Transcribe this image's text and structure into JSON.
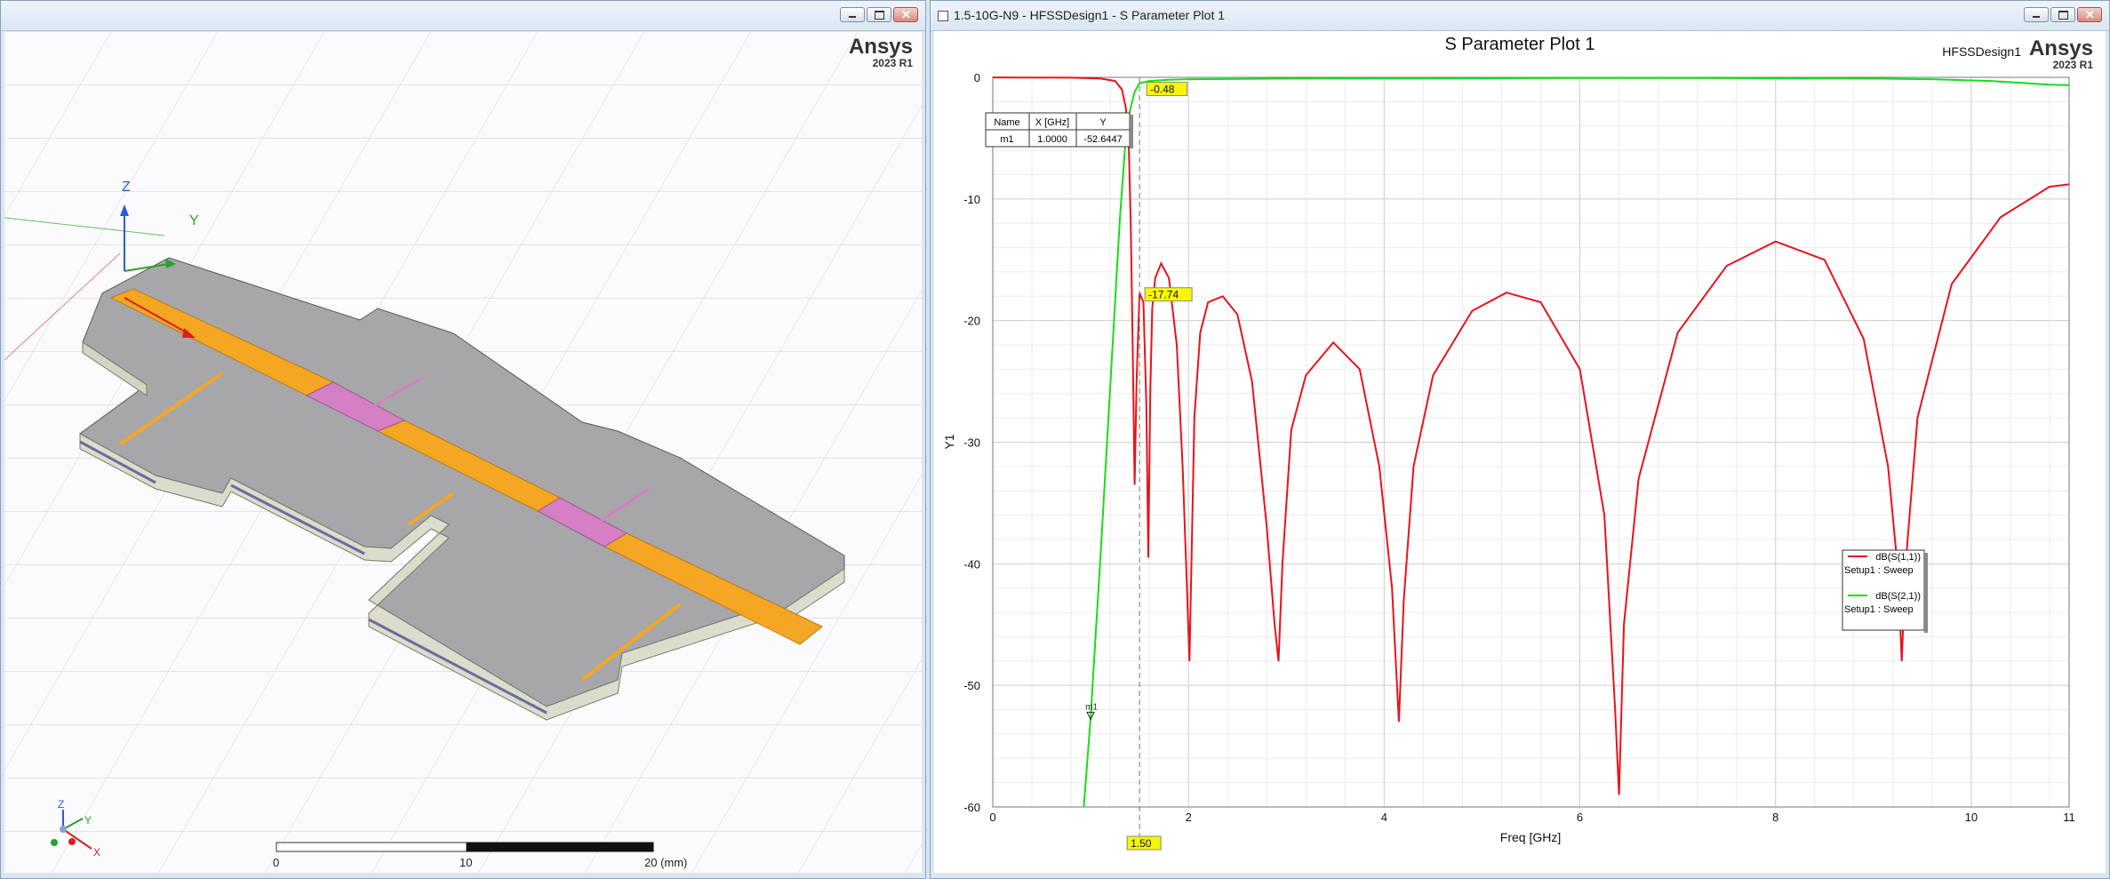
{
  "left_window": {
    "brand": {
      "name": "Ansys",
      "version": "2023 R1"
    },
    "axes": {
      "z": "Z",
      "y": "Y",
      "x": "X"
    },
    "scale_bar": {
      "labels": [
        "0",
        "10",
        "20 (mm)"
      ]
    }
  },
  "right_window": {
    "title": "1.5-10G-N9 - HFSSDesign1 - S Parameter Plot 1",
    "brand": {
      "name": "Ansys",
      "version": "2023 R1"
    },
    "design_label": "HFSSDesign1",
    "marker_table": {
      "headers": [
        "Name",
        "X [GHz]",
        "Y"
      ],
      "row": [
        "m1",
        "1.0000",
        "-52.6447"
      ]
    },
    "legend": [
      {
        "name": "dB(S(1,1))",
        "sub": "Setup1 : Sweep",
        "color": "#e8131b"
      },
      {
        "name": "dB(S(2,1))",
        "sub": "Setup1 : Sweep",
        "color": "#19dc19"
      }
    ],
    "cursor_labels": {
      "x": "1.50",
      "s21": "-0.48",
      "s11": "-17.74",
      "marker": "m1"
    }
  },
  "chart_data": {
    "type": "line",
    "title": "S Parameter Plot 1",
    "xlabel": "Freq [GHz]",
    "ylabel": "Y1",
    "xlim": [
      0,
      11
    ],
    "ylim": [
      -60,
      0
    ],
    "xticks": [
      0,
      2,
      4,
      6,
      8,
      10,
      11
    ],
    "yticks": [
      0,
      -10,
      -20,
      -30,
      -40,
      -50,
      -60
    ],
    "grid": true,
    "legend_position": "right",
    "series": [
      {
        "name": "dB(S(1,1))",
        "color": "#e8131b",
        "x": [
          0,
          0.8,
          1.1,
          1.25,
          1.32,
          1.36,
          1.39,
          1.41,
          1.43,
          1.45,
          1.47,
          1.5,
          1.54,
          1.57,
          1.59,
          1.61,
          1.63,
          1.66,
          1.72,
          1.8,
          1.88,
          1.94,
          1.98,
          2.01,
          2.03,
          2.06,
          2.12,
          2.2,
          2.35,
          2.5,
          2.65,
          2.8,
          2.88,
          2.92,
          2.96,
          3.05,
          3.2,
          3.48,
          3.75,
          3.95,
          4.08,
          4.15,
          4.2,
          4.3,
          4.5,
          4.9,
          5.25,
          5.6,
          6.0,
          6.25,
          6.36,
          6.4,
          6.45,
          6.6,
          7.0,
          7.5,
          8.0,
          8.5,
          8.9,
          9.15,
          9.25,
          9.29,
          9.33,
          9.45,
          9.8,
          10.3,
          10.8,
          11.0
        ],
        "y": [
          -0.01,
          -0.03,
          -0.1,
          -0.3,
          -1.0,
          -2.5,
          -5.5,
          -12,
          -22,
          -33.5,
          -25,
          -17.74,
          -18.5,
          -27,
          -39.5,
          -26,
          -19,
          -16.5,
          -15.3,
          -16.5,
          -22,
          -32,
          -41,
          -48,
          -40,
          -28,
          -21,
          -18.5,
          -18.0,
          -19.5,
          -25,
          -37,
          -45,
          -48,
          -40,
          -29,
          -24.5,
          -21.8,
          -24,
          -32,
          -42,
          -53,
          -43,
          -32,
          -24.5,
          -19.2,
          -17.7,
          -18.5,
          -24,
          -36,
          -52,
          -59,
          -45,
          -33,
          -21,
          -15.5,
          -13.5,
          -15,
          -21.5,
          -32,
          -40.5,
          -48,
          -40,
          -28,
          -17,
          -11.5,
          -9.0,
          -8.8
        ]
      },
      {
        "name": "dB(S(2,1))",
        "color": "#19dc19",
        "x": [
          0.93,
          1.0,
          1.05,
          1.1,
          1.15,
          1.2,
          1.25,
          1.3,
          1.35,
          1.4,
          1.45,
          1.5,
          1.6,
          1.8,
          2.0,
          3.0,
          5.0,
          6.0,
          7.0,
          8.0,
          9.0,
          9.6,
          10.2,
          10.8,
          11.0
        ],
        "y": [
          -60,
          -52.6447,
          -46,
          -39.5,
          -32.5,
          -25.5,
          -18.5,
          -11.5,
          -6.0,
          -2.8,
          -1.2,
          -0.48,
          -0.3,
          -0.2,
          -0.15,
          -0.1,
          -0.08,
          -0.05,
          -0.05,
          -0.08,
          -0.1,
          -0.15,
          -0.3,
          -0.6,
          -0.65
        ]
      }
    ],
    "markers": [
      {
        "name": "m1",
        "x": 1.0,
        "y": -52.6447
      }
    ],
    "cursor": {
      "x": 1.5
    }
  }
}
